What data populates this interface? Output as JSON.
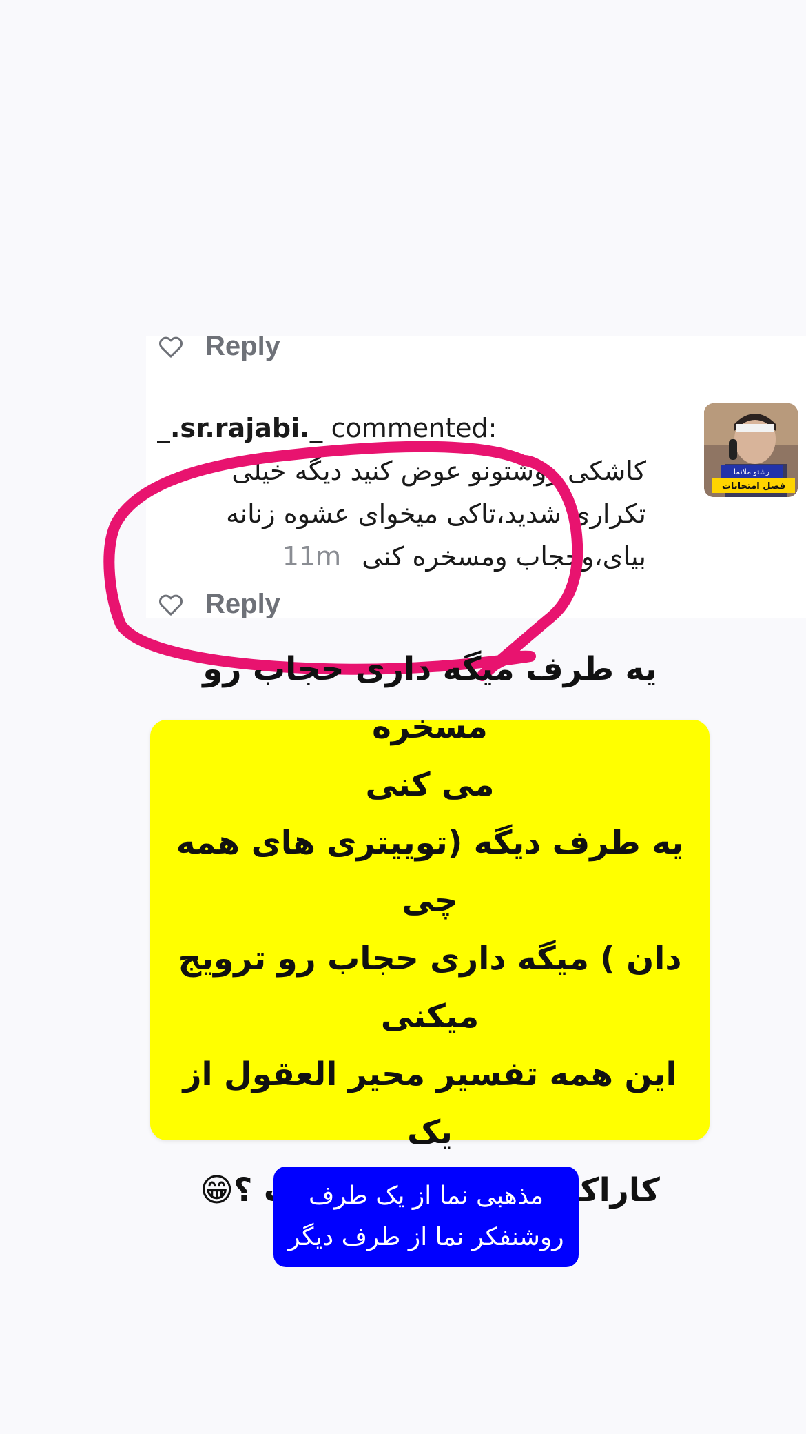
{
  "comment": {
    "reply_label_top": "Reply",
    "reply_label_bottom": "Reply",
    "username": "_.sr.rajabi._",
    "action": "commented:",
    "body": "کاشکی روشتونو عوض کنید دیگه خیلی تکراری شدید،تاکی میخوای عشوه زنانه بیای،وحجاب ومسخره کنی",
    "time": "11m",
    "avatar_caption_1": "رشتو ملانما",
    "avatar_caption_2": "فصل امتحانات"
  },
  "overlay": {
    "highlight_color": "#e8136f"
  },
  "yellow_note": {
    "background": "#ffff00",
    "line1": "یه طرف میگه داری حجاب رو مسخره",
    "line2": "می کنی",
    "line3": "یه طرف دیگه (توییتری های همه چی",
    "line4": "دان ) میگه داری حجاب رو ترویج",
    "line5": "میکنی",
    "line6": "این همه تفسیر محیر العقول از یک",
    "line7": "کاراکتر طنز عجیب نیست ؟😁"
  },
  "blue_note": {
    "background": "#0000ff",
    "line1": "مذهبی  نما از یک طرف",
    "line2": "روشنفکر نما از طرف دیگر"
  }
}
